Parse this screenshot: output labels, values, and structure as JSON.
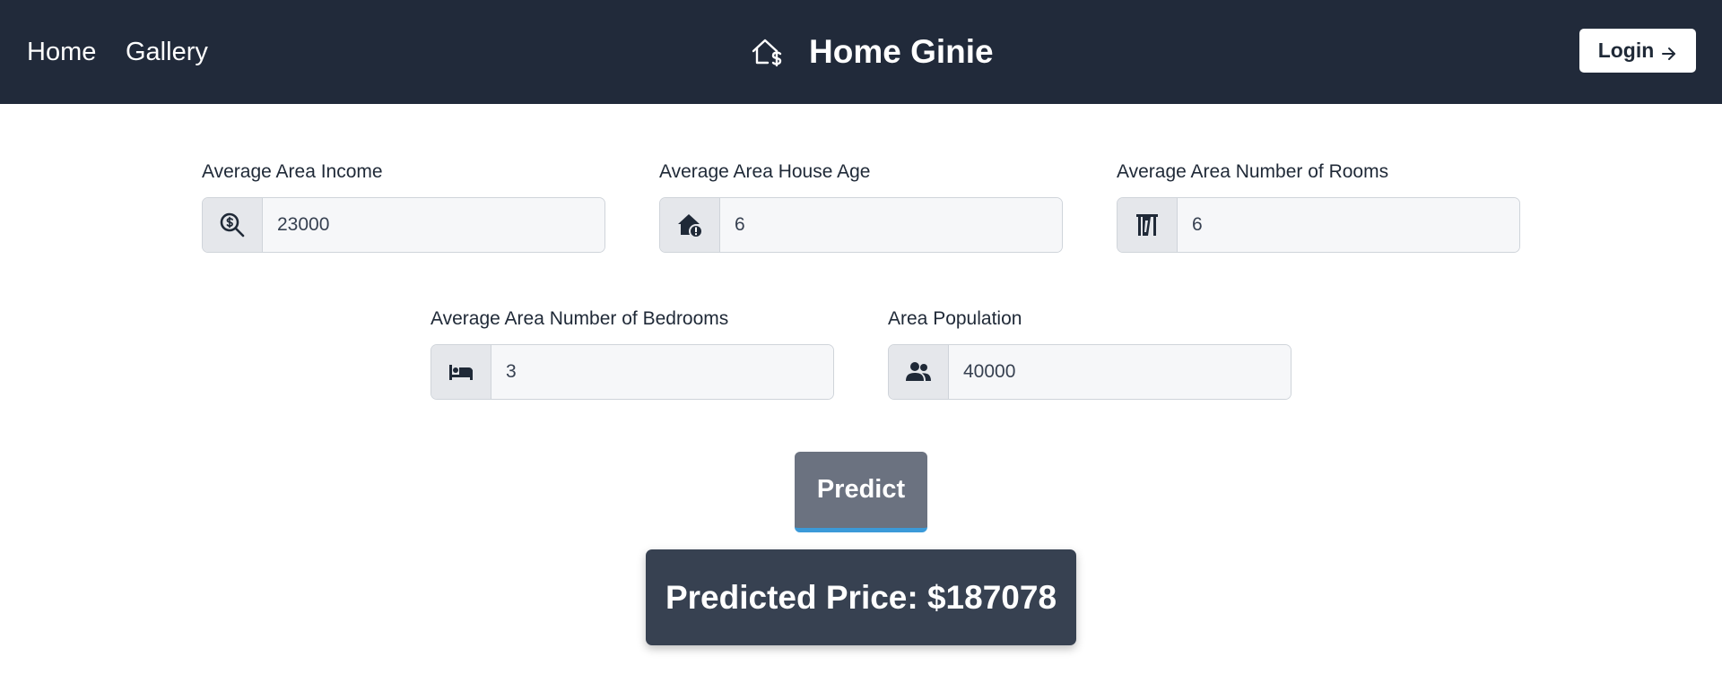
{
  "nav": {
    "links": [
      {
        "label": "Home"
      },
      {
        "label": "Gallery"
      }
    ],
    "brand_title": "Home Ginie",
    "brand_icon": "house-dollar-icon",
    "login_label": "Login",
    "login_icon": "arrow-right-icon"
  },
  "form": {
    "fields": [
      {
        "label": "Average Area Income",
        "value": "23000",
        "icon": "search-dollar-icon"
      },
      {
        "label": "Average Area House Age",
        "value": "6",
        "icon": "house-alert-icon"
      },
      {
        "label": "Average Area Number of Rooms",
        "value": "6",
        "icon": "door-open-icon"
      },
      {
        "label": "Average Area Number of Bedrooms",
        "value": "3",
        "icon": "bed-icon"
      },
      {
        "label": "Area Population",
        "value": "40000",
        "icon": "users-icon"
      }
    ],
    "predict_label": "Predict"
  },
  "result": {
    "text": "Predicted Price: $187078"
  },
  "colors": {
    "navbar": "#212a3a",
    "predict_button": "#6b7280",
    "predict_accent": "#3b9ad9",
    "result_box": "#374151"
  }
}
